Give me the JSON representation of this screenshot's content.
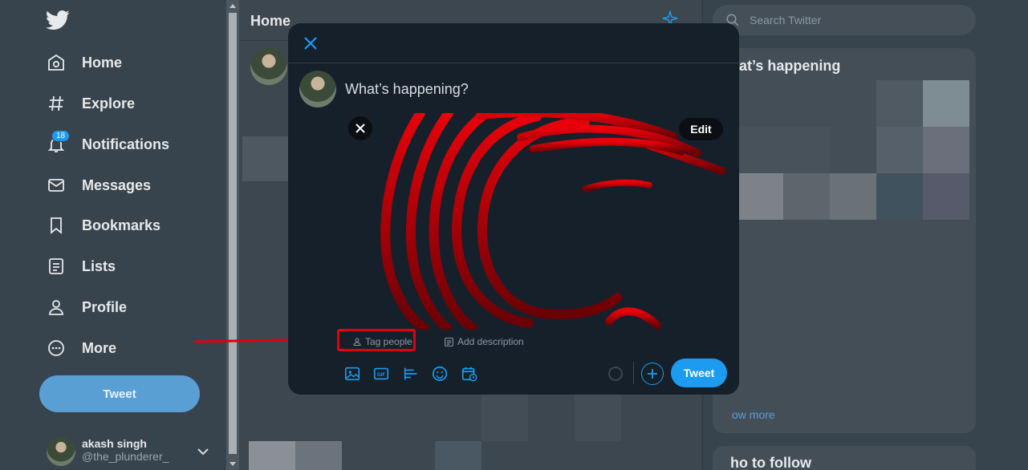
{
  "sidebar": {
    "items": [
      {
        "label": "Home",
        "icon": "home-icon"
      },
      {
        "label": "Explore",
        "icon": "hashtag-icon"
      },
      {
        "label": "Notifications",
        "icon": "bell-icon"
      },
      {
        "label": "Messages",
        "icon": "envelope-icon"
      },
      {
        "label": "Bookmarks",
        "icon": "bookmark-icon"
      },
      {
        "label": "Lists",
        "icon": "list-icon"
      },
      {
        "label": "Profile",
        "icon": "person-icon"
      },
      {
        "label": "More",
        "icon": "more-icon"
      }
    ],
    "notification_count": "18",
    "tweet_label": "Tweet",
    "account": {
      "name": "akash singh",
      "handle": "@the_plunderer_"
    }
  },
  "feed": {
    "title": "Home"
  },
  "right": {
    "search_placeholder": "Search Twitter",
    "trends_title": "hat’s happening",
    "show_more": "ow more",
    "who_to_follow": "ho to follow"
  },
  "composer": {
    "placeholder": "What’s happening?",
    "edit_label": "Edit",
    "tag_people_label": "Tag people",
    "add_description_label": "Add description",
    "tweet_label": "Tweet"
  },
  "colors": {
    "accent": "#1d9bf0",
    "highlight": "#e0000f",
    "modal_bg": "#15202b"
  }
}
